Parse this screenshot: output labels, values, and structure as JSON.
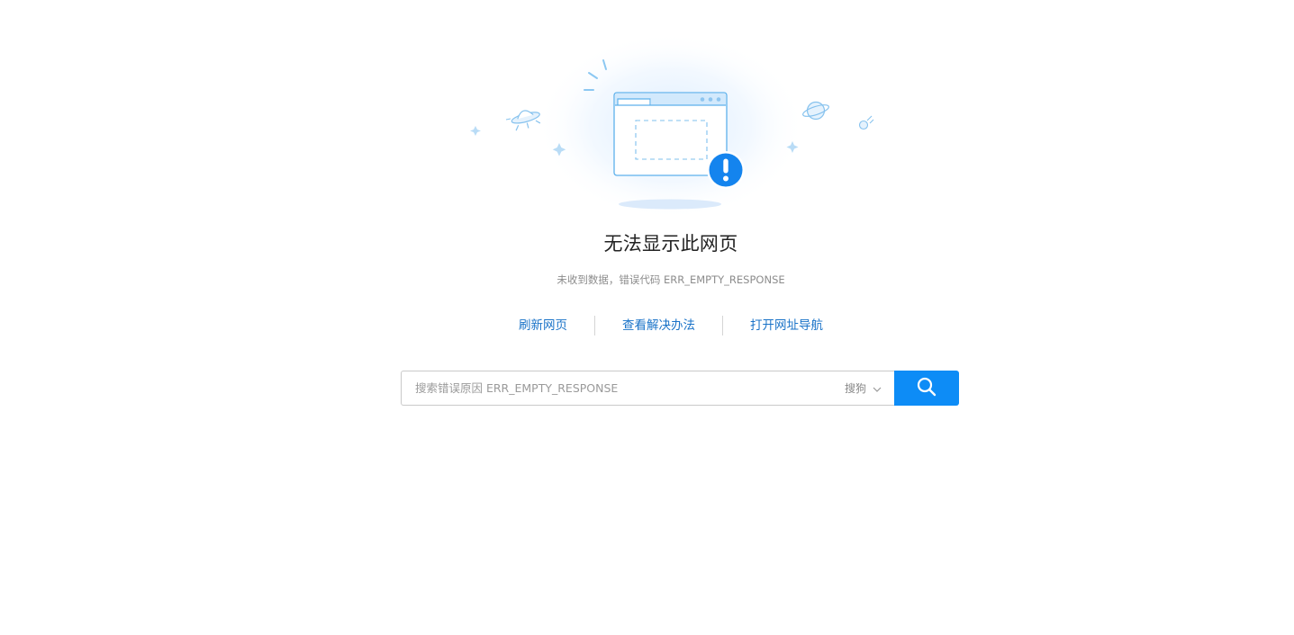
{
  "error": {
    "title": "无法显示此网页",
    "message": "未收到数据，错误代码 ERR_EMPTY_RESPONSE"
  },
  "actions": [
    {
      "label": "刷新网页"
    },
    {
      "label": "查看解决办法"
    },
    {
      "label": "打开网址导航"
    }
  ],
  "search": {
    "placeholder": "搜索错误原因 ERR_EMPTY_RESPONSE",
    "value": "",
    "engine": "搜狗",
    "button_icon": "search-icon"
  },
  "colors": {
    "accent": "#0d8cf6",
    "link": "#1a73c8",
    "illustration_stroke": "#6ab8ef",
    "illustration_fill": "#dcefff",
    "alert": "#1484ee"
  },
  "illustration": {
    "icons": [
      "browser-window-icon",
      "alert-icon",
      "ufo-icon",
      "planet-icon",
      "comet-icon",
      "sparkle-icon"
    ]
  }
}
